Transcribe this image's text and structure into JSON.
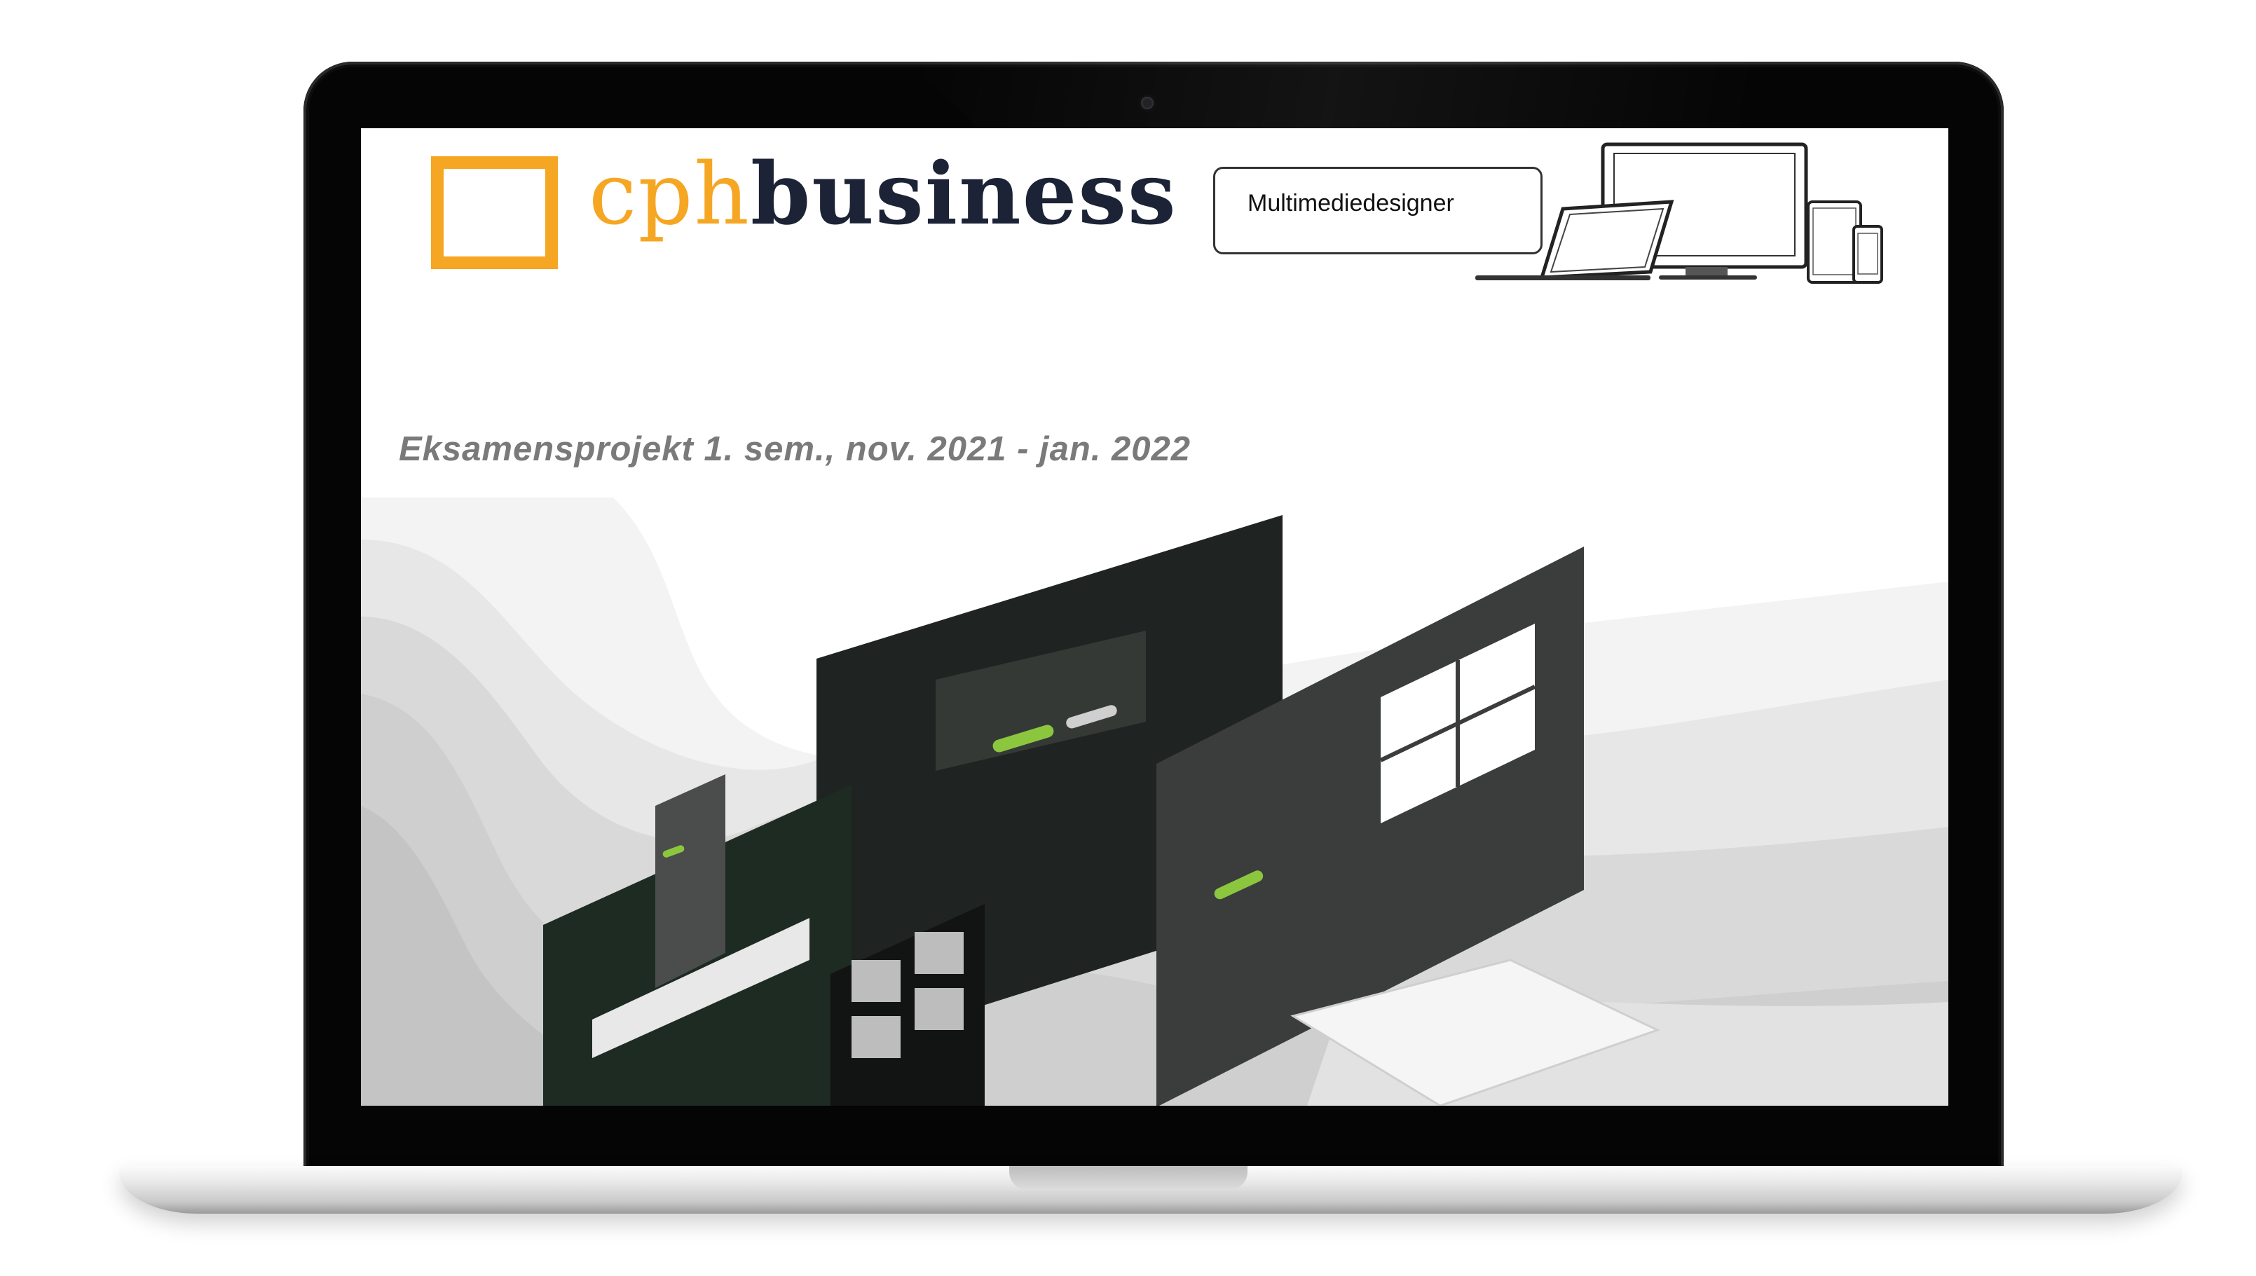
{
  "brand": {
    "name_part1": "cph",
    "name_part2": "business",
    "accent_color": "#f5a623",
    "text_color": "#1c2336"
  },
  "program": {
    "label": "Multimediedesigner"
  },
  "headline": {
    "text": "Eksamensprojekt 1. sem., nov. 2021 - jan. 2022"
  },
  "hero": {
    "cta_color": "#8cc63f",
    "panel_color": "#1f2321"
  },
  "icons": [
    "laptop-icon",
    "monitor-icon",
    "tablet-icon",
    "phone-icon",
    "camera-icon"
  ]
}
